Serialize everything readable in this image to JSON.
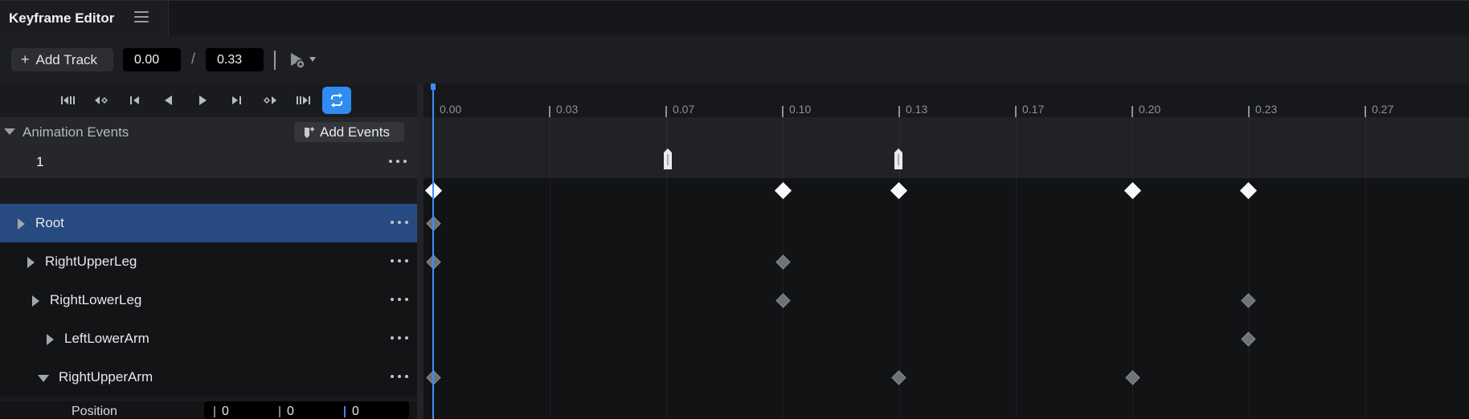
{
  "title_tab": {
    "title": "Keyframe Editor",
    "menu_icon": "hamburger-menu-icon"
  },
  "toolbar": {
    "add_track_icon": "plus-icon",
    "add_track_label": "Add Track",
    "time_start": "0.00",
    "separator": "/",
    "time_end": "0.33",
    "play_settings_icon": "play-settings-icon"
  },
  "transport": {
    "buttons": [
      {
        "name": "go-to-start",
        "icon": "skip-to-start-icon"
      },
      {
        "name": "prev-keyframe",
        "icon": "prev-keyframe-icon"
      },
      {
        "name": "step-back",
        "icon": "step-back-icon"
      },
      {
        "name": "play-reverse",
        "icon": "play-reverse-icon"
      },
      {
        "name": "play",
        "icon": "play-icon"
      },
      {
        "name": "step-forward",
        "icon": "step-forward-icon"
      },
      {
        "name": "next-keyframe",
        "icon": "next-keyframe-icon"
      },
      {
        "name": "go-to-end",
        "icon": "skip-to-end-icon"
      },
      {
        "name": "loop",
        "icon": "loop-icon",
        "active": true
      }
    ]
  },
  "events": {
    "title": "Animation Events",
    "add_events_label": "Add Events",
    "add_events_icon": "add-event-icon",
    "rows": [
      {
        "label": "1"
      }
    ]
  },
  "tracks": [
    {
      "label": "Root",
      "expanded": false,
      "selected": true
    },
    {
      "label": "RightUpperLeg",
      "expanded": false,
      "selected": false
    },
    {
      "label": "RightLowerLeg",
      "expanded": false,
      "selected": false
    },
    {
      "label": "LeftLowerArm",
      "expanded": false,
      "selected": false
    },
    {
      "label": "RightUpperArm",
      "expanded": true,
      "selected": false
    }
  ],
  "property": {
    "label": "Position",
    "x": "0",
    "y": "0",
    "z": "0"
  },
  "timeline": {
    "tick_labels": [
      "0.00",
      "0.03",
      "0.07",
      "0.10",
      "0.13",
      "0.17",
      "0.20",
      "0.23",
      "0.27"
    ],
    "playhead_time": 0.0,
    "event_markers": [
      0.067,
      0.133
    ],
    "summary_keyframes": [
      0.0,
      0.1,
      0.133,
      0.2,
      0.233
    ],
    "track_keyframes": [
      [
        0.0
      ],
      [
        0.0,
        0.1
      ],
      [
        0.1,
        0.233
      ],
      [
        0.233
      ],
      [
        0.0,
        0.133,
        0.2
      ]
    ]
  },
  "colors": {
    "accent": "#2f8cf0",
    "selected_row": "#274a80",
    "playhead": "#3d8ff2"
  }
}
